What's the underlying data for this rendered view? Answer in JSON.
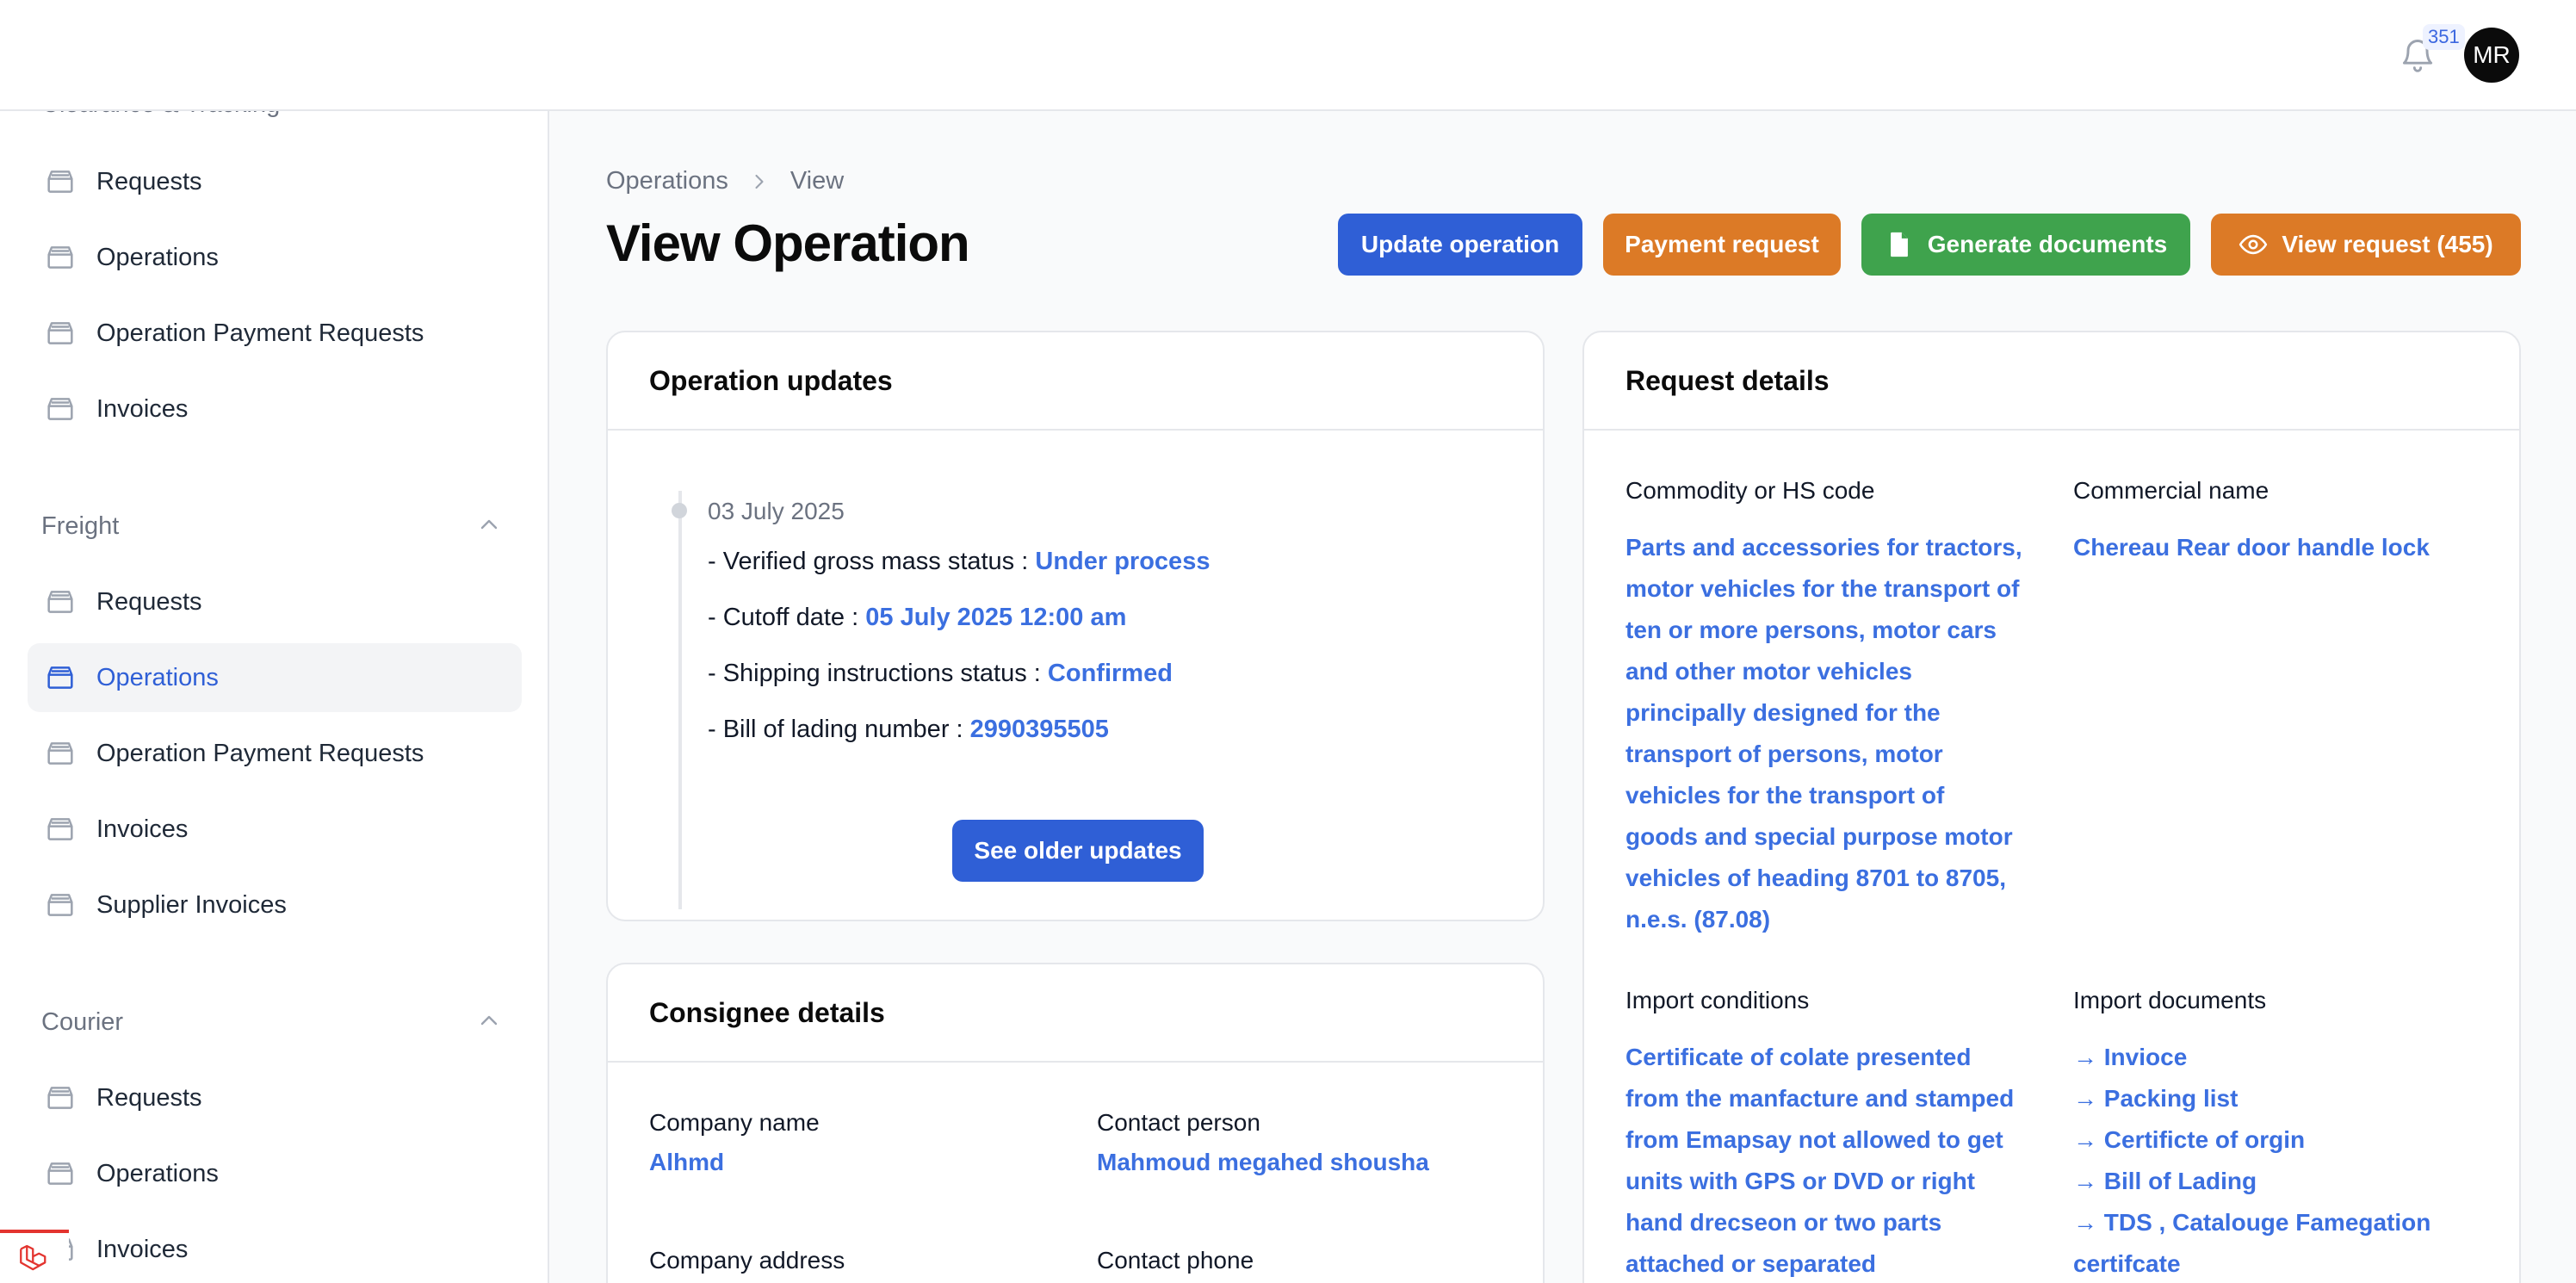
{
  "header": {
    "notification_count": "351",
    "avatar_initials": "MR"
  },
  "sidebar": {
    "cut_group_label": "Clearance & Tracking",
    "group1_items": [
      "Requests",
      "Operations",
      "Operation Payment Requests",
      "Invoices"
    ],
    "freight": {
      "label": "Freight",
      "items": [
        "Requests",
        "Operations",
        "Operation Payment Requests",
        "Invoices",
        "Supplier Invoices"
      ],
      "active_item": "Operations"
    },
    "courier": {
      "label": "Courier",
      "items": [
        "Requests",
        "Operations",
        "Invoices"
      ]
    }
  },
  "breadcrumb": [
    "Operations",
    "View"
  ],
  "page": {
    "title": "View Operation"
  },
  "actions": {
    "update": "Update operation",
    "payment": "Payment request",
    "generate": "Generate documents",
    "view_request": "View request (455)"
  },
  "operation_updates": {
    "title": "Operation updates",
    "date": "03 July 2025",
    "entries": [
      {
        "label": "- Verified gross mass status :",
        "value": "Under process"
      },
      {
        "label": "- Cutoff date :",
        "value": "05 July 2025 12:00 am"
      },
      {
        "label": "- Shipping instructions status :",
        "value": "Confirmed"
      },
      {
        "label": "- Bill of lading number :",
        "value": "2990395505"
      }
    ],
    "older_button": "See older updates"
  },
  "consignee": {
    "title": "Consignee details",
    "company_name_label": "Company name",
    "company_name": "Alhmd",
    "contact_person_label": "Contact person",
    "contact_person": "Mahmoud megahed shousha",
    "company_address_label": "Company address",
    "contact_phone_label": "Contact phone"
  },
  "request_details": {
    "title": "Request details",
    "commodity_label": "Commodity or HS code",
    "commodity_lines": [
      "Parts and accessories for tractors,",
      "motor vehicles for the transport of",
      "ten or more persons, motor cars",
      "and other motor vehicles",
      "principally designed for the",
      "transport of persons, motor",
      "vehicles for the transport of",
      "goods and special purpose motor",
      "vehicles of heading 8701 to 8705,",
      "n.e.s. (87.08)"
    ],
    "commercial_name_label": "Commercial name",
    "commercial_name": "Chereau Rear door handle lock",
    "import_conditions_label": "Import conditions",
    "import_conditions_lines": [
      "Certificate of colate presented",
      "from the manfacture and stamped",
      "from Emapsay not allowed to get",
      "units with GPS or DVD or right",
      "hand drecseon or two parts",
      "attached or separated"
    ],
    "import_documents_label": "Import documents",
    "import_documents": [
      "→ Invioce",
      "→ Packing list",
      "→ Certificte of orgin",
      "→ Bill of Lading",
      "→ TDS , Catalouge Famegation",
      "certifcate"
    ]
  }
}
